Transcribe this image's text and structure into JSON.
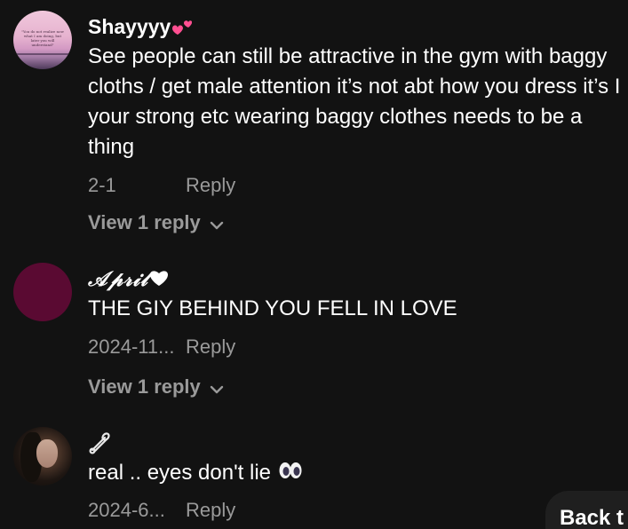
{
  "comments": [
    {
      "username": "Shayyyy",
      "username_emoji": "two-hearts",
      "avatar_text": "\"You do not realize now what I am doing, but later you will understand\"",
      "text": "See people can still be attractive in the gym with baggy cloths / get male attention it’s not abt how you dress it’s I your strong etc wearing baggy clothes needs to be a thing",
      "date": "2-1",
      "reply_label": "Reply",
      "view_replies_label": "View 1 reply"
    },
    {
      "username": "𝒜𝓅𝓇𝒾𝓁",
      "username_emoji": "white-heart",
      "text": "THE GIY BEHIND YOU FELL IN LOVE",
      "date": "2024-11...",
      "reply_label": "Reply",
      "view_replies_label": "View 1 reply"
    },
    {
      "username": "",
      "username_emoji": "safety-pin",
      "text": "real .. eyes don't lie",
      "text_emoji": "eyes",
      "date": "2024-6...",
      "reply_label": "Reply"
    }
  ],
  "back_button": {
    "label": "Back t"
  },
  "colors": {
    "background": "#121212",
    "text_primary": "#ffffff",
    "text_secondary": "#9a9a9a",
    "heart_pink": "#ff4f91"
  }
}
